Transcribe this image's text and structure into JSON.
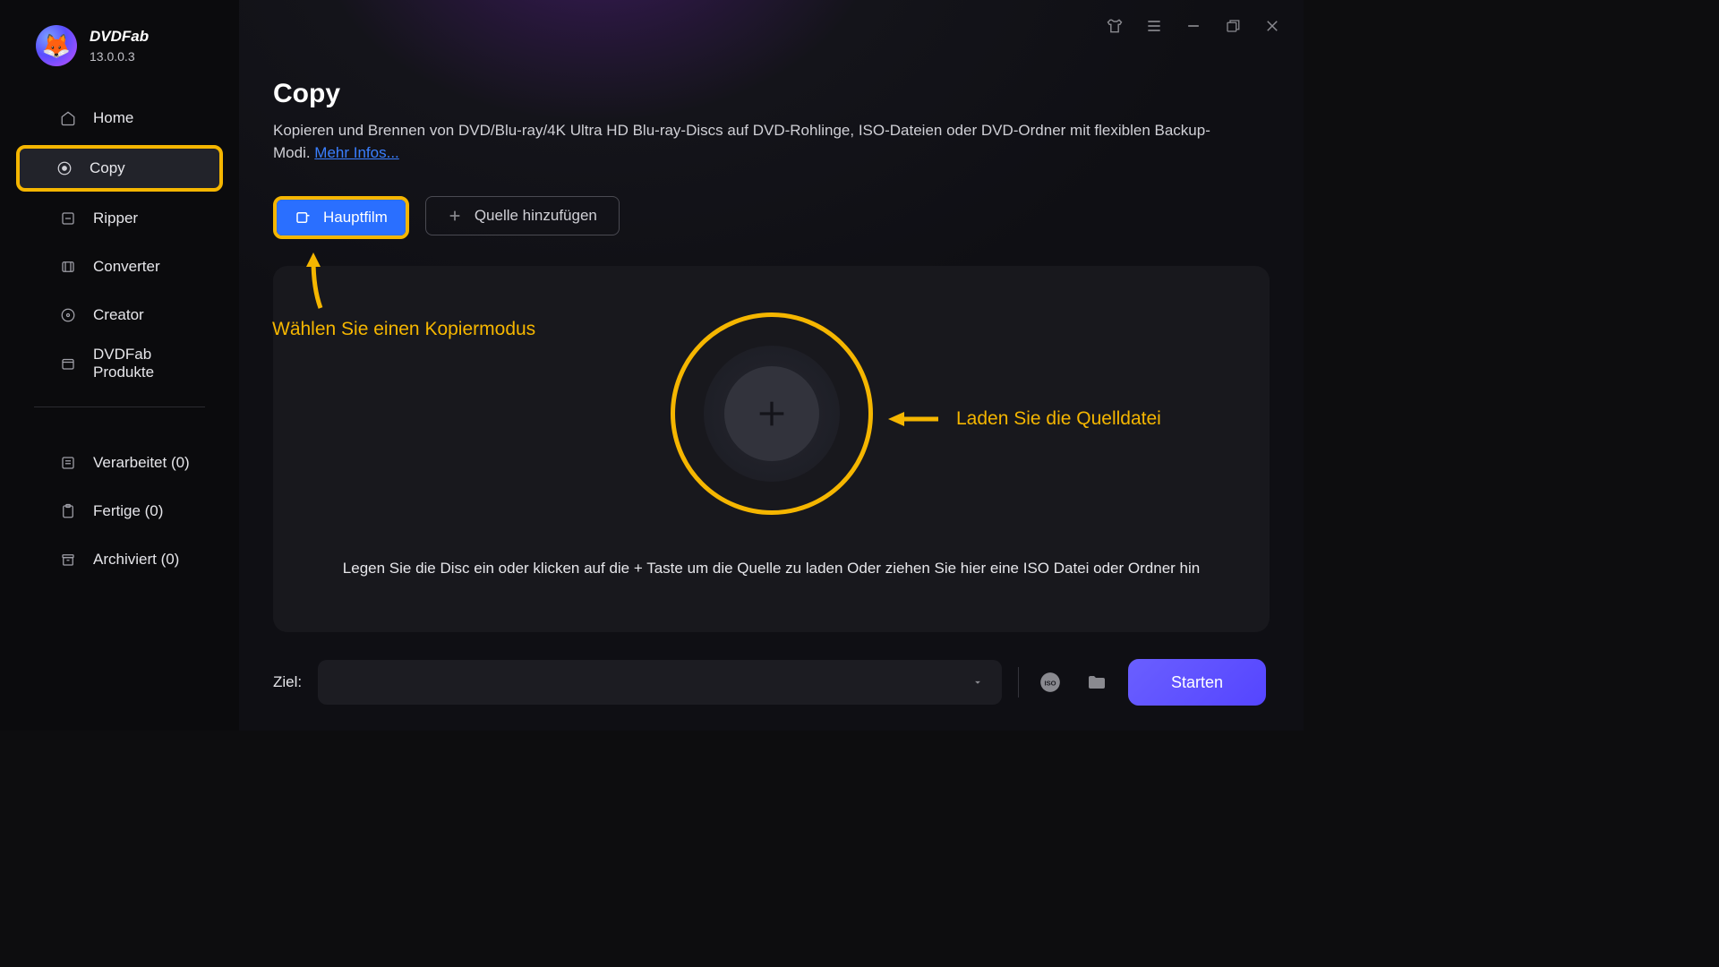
{
  "brand": {
    "name": "DVDFab",
    "version": "13.0.0.3"
  },
  "sidebar": {
    "items": [
      {
        "label": "Home"
      },
      {
        "label": "Copy"
      },
      {
        "label": "Ripper"
      },
      {
        "label": "Converter"
      },
      {
        "label": "Creator"
      },
      {
        "label": "DVDFab Produkte"
      }
    ],
    "status": [
      {
        "label": "Verarbeitet (0)"
      },
      {
        "label": "Fertige (0)"
      },
      {
        "label": "Archiviert (0)"
      }
    ]
  },
  "page": {
    "title": "Copy",
    "description": "Kopieren und Brennen von DVD/Blu-ray/4K Ultra HD Blu-ray-Discs auf DVD-Rohlinge, ISO-Dateien oder DVD-Ordner mit flexiblen Backup-Modi. ",
    "more_link": "Mehr Infos..."
  },
  "actions": {
    "mode_label": "Hauptfilm",
    "add_label": "Quelle hinzufügen"
  },
  "drop": {
    "text": "Legen Sie die Disc ein oder klicken auf die + Taste um die Quelle zu laden Oder ziehen Sie hier eine ISO Datei oder Ordner hin"
  },
  "annotations": {
    "mode": "Wählen Sie einen Kopiermodus",
    "load": "Laden Sie die Quelldatei"
  },
  "footer": {
    "dest_label": "Ziel:",
    "start_label": "Starten"
  }
}
